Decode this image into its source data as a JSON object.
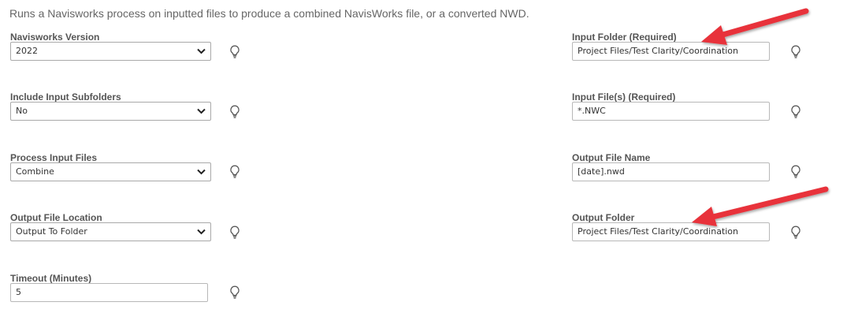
{
  "description": "Runs a Navisworks process on inputted files to produce a combined NavisWorks file, or a converted NWD.",
  "left_fields": [
    {
      "label": "Navisworks Version",
      "value": "2022",
      "type": "select"
    },
    {
      "label": "Include Input Subfolders",
      "value": "No",
      "type": "select"
    },
    {
      "label": "Process Input Files",
      "value": "Combine",
      "type": "select"
    },
    {
      "label": "Output File Location",
      "value": "Output To Folder",
      "type": "select"
    },
    {
      "label": "Timeout (Minutes)",
      "value": "5",
      "type": "text"
    }
  ],
  "right_fields": [
    {
      "label": "Input Folder (Required)",
      "value": "Project Files/Test Clarity/Coordination",
      "type": "text"
    },
    {
      "label": "Input File(s) (Required)",
      "value": "*.NWC",
      "type": "text"
    },
    {
      "label": "Output File Name",
      "value": "[date].nwd",
      "type": "text"
    },
    {
      "label": "Output Folder",
      "value": "Project Files/Test Clarity/Coordination",
      "type": "text"
    }
  ],
  "icons": {
    "tip": "lightbulb-icon",
    "dropdown": "chevron-down-icon",
    "annotation": "red-arrow-annotation"
  },
  "colors": {
    "arrow": "#e8333a",
    "label": "#555555",
    "description": "#666666",
    "border": "#b8b8b8"
  }
}
